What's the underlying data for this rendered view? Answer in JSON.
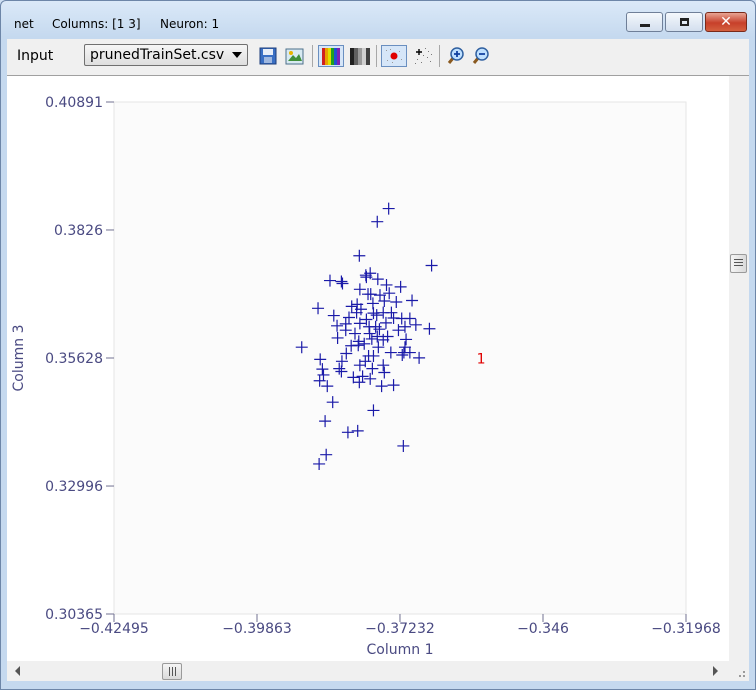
{
  "window": {
    "title": "net",
    "columns_text": "Columns: [1  3]",
    "neuron_text": "Neuron: 1"
  },
  "toolbar": {
    "input_label": "Input",
    "file_selected": "prunedTrainSet.csv",
    "icons": [
      "save-icon",
      "export-image-icon",
      "color-palette-icon",
      "grayscale-palette-icon",
      "show-neurons-icon",
      "show-data-points-icon",
      "zoom-in-icon",
      "zoom-out-icon"
    ]
  },
  "colors": {
    "points": "#1a1aa8",
    "neuron_label": "#e00000",
    "axis_text": "#4a4a82"
  },
  "chart_data": {
    "type": "scatter",
    "xlabel": "Column 1",
    "ylabel": "Column 3",
    "xlim": [
      -0.42495,
      -0.31968
    ],
    "ylim": [
      0.30365,
      0.40891
    ],
    "x_ticks": [
      -0.42495,
      -0.39863,
      -0.37232,
      -0.346,
      -0.31968
    ],
    "x_tick_labels": [
      "−0.42495",
      "−0.39863",
      "−0.37232",
      "−0.346",
      "−0.31968"
    ],
    "y_ticks": [
      0.40891,
      0.3826,
      0.35628,
      0.32996,
      0.30365
    ],
    "y_tick_labels": [
      "0.40891",
      "0.3826",
      "0.35628",
      "0.32996",
      "0.30365"
    ],
    "marker": "+",
    "points": [
      [
        -0.3765,
        0.3843
      ],
      [
        -0.3744,
        0.387
      ],
      [
        -0.3665,
        0.3753
      ],
      [
        -0.3798,
        0.3773
      ],
      [
        -0.3785,
        0.3729
      ],
      [
        -0.3778,
        0.3737
      ],
      [
        -0.3786,
        0.3733
      ],
      [
        -0.3764,
        0.3725
      ],
      [
        -0.3852,
        0.3722
      ],
      [
        -0.3831,
        0.372
      ],
      [
        -0.3829,
        0.3716
      ],
      [
        -0.3722,
        0.3709
      ],
      [
        -0.3748,
        0.3713
      ],
      [
        -0.3701,
        0.3681
      ],
      [
        -0.3797,
        0.3704
      ],
      [
        -0.3782,
        0.3694
      ],
      [
        -0.3777,
        0.3694
      ],
      [
        -0.376,
        0.3692
      ],
      [
        -0.3743,
        0.3696
      ],
      [
        -0.3773,
        0.3675
      ],
      [
        -0.373,
        0.3678
      ],
      [
        -0.3795,
        0.3663
      ],
      [
        -0.3802,
        0.3673
      ],
      [
        -0.3874,
        0.3665
      ],
      [
        -0.3812,
        0.3669
      ],
      [
        -0.3772,
        0.3655
      ],
      [
        -0.3803,
        0.3656
      ],
      [
        -0.3817,
        0.3646
      ],
      [
        -0.3785,
        0.3642
      ],
      [
        -0.3766,
        0.3651
      ],
      [
        -0.3754,
        0.3656
      ],
      [
        -0.3739,
        0.3656
      ],
      [
        -0.3735,
        0.3645
      ],
      [
        -0.372,
        0.3644
      ],
      [
        -0.3705,
        0.3644
      ],
      [
        -0.3694,
        0.3631
      ],
      [
        -0.3749,
        0.3635
      ],
      [
        -0.3768,
        0.3627
      ],
      [
        -0.378,
        0.3627
      ],
      [
        -0.3797,
        0.3634
      ],
      [
        -0.3823,
        0.3633
      ],
      [
        -0.3839,
        0.3629
      ],
      [
        -0.3669,
        0.3623
      ],
      [
        -0.3714,
        0.3627
      ],
      [
        -0.3726,
        0.362
      ],
      [
        -0.3761,
        0.3622
      ],
      [
        -0.3779,
        0.3613
      ],
      [
        -0.3806,
        0.3613
      ],
      [
        -0.3823,
        0.362
      ],
      [
        -0.3904,
        0.3585
      ],
      [
        -0.3838,
        0.3604
      ],
      [
        -0.3799,
        0.3597
      ],
      [
        -0.3775,
        0.3602
      ],
      [
        -0.3765,
        0.3607
      ],
      [
        -0.3746,
        0.3607
      ],
      [
        -0.3712,
        0.3601
      ],
      [
        -0.3789,
        0.3592
      ],
      [
        -0.38,
        0.3589
      ],
      [
        -0.3813,
        0.3588
      ],
      [
        -0.3714,
        0.3585
      ],
      [
        -0.3719,
        0.3569
      ],
      [
        -0.3688,
        0.3563
      ],
      [
        -0.3822,
        0.3572
      ],
      [
        -0.3781,
        0.3567
      ],
      [
        -0.3772,
        0.3567
      ],
      [
        -0.383,
        0.3556
      ],
      [
        -0.3774,
        0.3541
      ],
      [
        -0.3754,
        0.3548
      ],
      [
        -0.3797,
        0.3548
      ],
      [
        -0.3835,
        0.3541
      ],
      [
        -0.3831,
        0.3535
      ],
      [
        -0.3864,
        0.3528
      ],
      [
        -0.3752,
        0.3533
      ],
      [
        -0.3778,
        0.352
      ],
      [
        -0.3792,
        0.3525
      ],
      [
        -0.3809,
        0.3523
      ],
      [
        -0.3871,
        0.3516
      ],
      [
        -0.3735,
        0.3507
      ],
      [
        -0.3857,
        0.3505
      ],
      [
        -0.3847,
        0.3472
      ],
      [
        -0.3772,
        0.3455
      ],
      [
        -0.3861,
        0.3433
      ],
      [
        -0.3819,
        0.341
      ],
      [
        -0.3801,
        0.3413
      ],
      [
        -0.3717,
        0.3382
      ],
      [
        -0.3859,
        0.3364
      ],
      [
        -0.3872,
        0.3345
      ],
      [
        -0.3757,
        0.3505
      ],
      [
        -0.3798,
        0.3513
      ],
      [
        -0.374,
        0.3574
      ],
      [
        -0.3705,
        0.3574
      ],
      [
        -0.3787,
        0.3556
      ],
      [
        -0.3763,
        0.3585
      ],
      [
        -0.3754,
        0.36
      ],
      [
        -0.3845,
        0.365
      ],
      [
        -0.387,
        0.356
      ],
      [
        -0.3866,
        0.354
      ],
      [
        -0.3752,
        0.368
      ],
      [
        -0.3716,
        0.3574
      ]
    ],
    "neurons": [
      {
        "label": "1",
        "x": -0.3574,
        "y": 0.3562
      }
    ]
  }
}
